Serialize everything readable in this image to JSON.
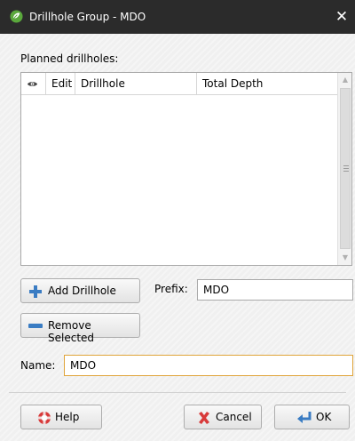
{
  "window": {
    "title": "Drillhole Group - MDO",
    "close_glyph": "✕"
  },
  "planned_label": "Planned drillholes:",
  "grid": {
    "columns": [
      "",
      "Edit",
      "Drillhole",
      "Total Depth"
    ],
    "rows": []
  },
  "buttons": {
    "add_drillhole": "Add Drillhole",
    "remove_selected": "Remove Selected",
    "help": "Help",
    "cancel": "Cancel",
    "ok": "OK"
  },
  "prefix": {
    "label": "Prefix:",
    "value": "MDO"
  },
  "name": {
    "label": "Name:",
    "value": "MDO"
  },
  "colors": {
    "titlebar": "#2b2b2b",
    "focus_border": "#e0a43a",
    "add_icon": "#3a7cc3",
    "remove_icon": "#3a7cc3",
    "cancel_icon": "#d83a3a",
    "help_icon": "#d83a3a",
    "ok_icon": "#3a7cc3"
  },
  "icons": {
    "app": "app-leaf-icon",
    "visibility": "eye-icon",
    "add": "plus-icon",
    "remove": "minus-icon",
    "help": "lifebuoy-icon",
    "cancel": "x-icon",
    "ok": "return-arrow-icon"
  }
}
